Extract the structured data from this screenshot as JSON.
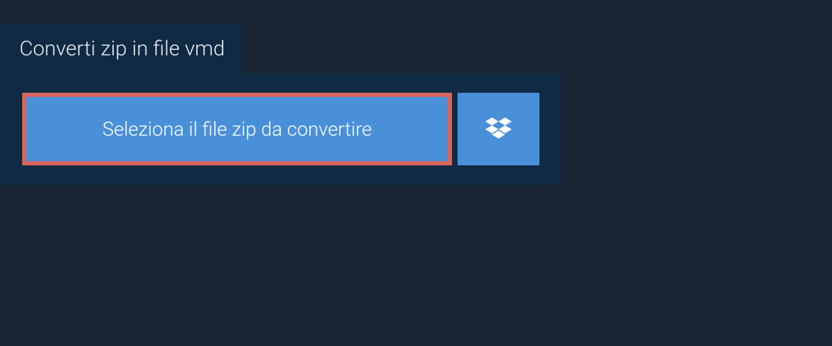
{
  "header": {
    "title": "Converti zip in file vmd"
  },
  "actions": {
    "select_file_label": "Seleziona il file zip da convertire"
  }
}
